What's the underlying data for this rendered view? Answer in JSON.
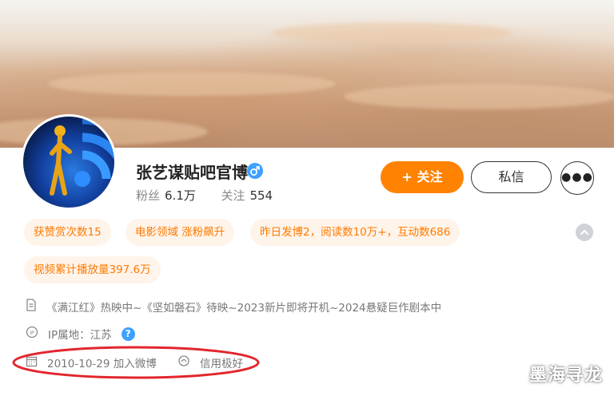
{
  "profile": {
    "name": "张艺谋贴吧官博",
    "gender_icon": "male-icon",
    "fans_label": "粉丝",
    "fans_value": "6.1万",
    "following_label": "关注",
    "following_value": "554"
  },
  "actions": {
    "follow_label": "+ 关注",
    "message_label": "私信",
    "more_icon": "more-dots-icon"
  },
  "tags": [
    {
      "label": "获赞赏次数15"
    },
    {
      "label": "电影领域 涨粉飙升"
    },
    {
      "label": "昨日发博2，阅读数10万+，互动数686"
    },
    {
      "label": "视频累计播放量397.6万"
    }
  ],
  "info": {
    "bio": "《满江红》热映中~《坚如磐石》待映~2023新片即将开机~2024悬疑巨作剧本中",
    "ip_location": "IP属地：江苏",
    "join_date": "2010-10-29 加入微博",
    "credit": "信用极好"
  },
  "watermark": "墨海寻龙",
  "colors": {
    "accent": "#ff8200",
    "tag_bg": "#fff4ea",
    "tag_text": "#ff7a00",
    "verified_blue": "#3ea1ff",
    "annotation_red": "#e2262c"
  }
}
